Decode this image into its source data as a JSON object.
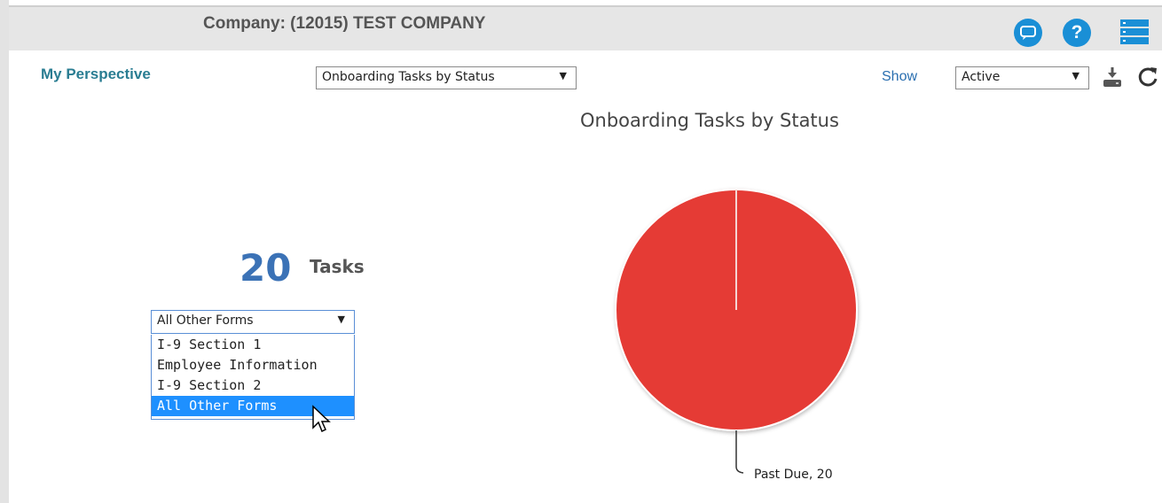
{
  "header": {
    "company": "Company: (12015) TEST COMPANY",
    "icons": [
      "chat-icon",
      "help-icon",
      "menu-icon"
    ],
    "accent": "#1a8fd6"
  },
  "toolbar": {
    "perspective_label": "My Perspective",
    "report_select_value": "Onboarding Tasks by Status",
    "show_label": "Show",
    "show_select_value": "Active",
    "icons": [
      "download-icon",
      "refresh-icon"
    ]
  },
  "summary": {
    "count": "20",
    "unit": "Tasks",
    "form_select_value": "All Other Forms",
    "form_options": [
      "I-9 Section 1",
      "Employee Information",
      "I-9 Section 2",
      "All Other Forms"
    ],
    "selected_option": "All Other Forms"
  },
  "chart_data": {
    "type": "pie",
    "title": "Onboarding Tasks by Status",
    "slices": [
      {
        "label": "Past Due",
        "value": 20,
        "color": "#e53a35"
      }
    ],
    "data_labels": [
      "Past Due, 20"
    ]
  }
}
